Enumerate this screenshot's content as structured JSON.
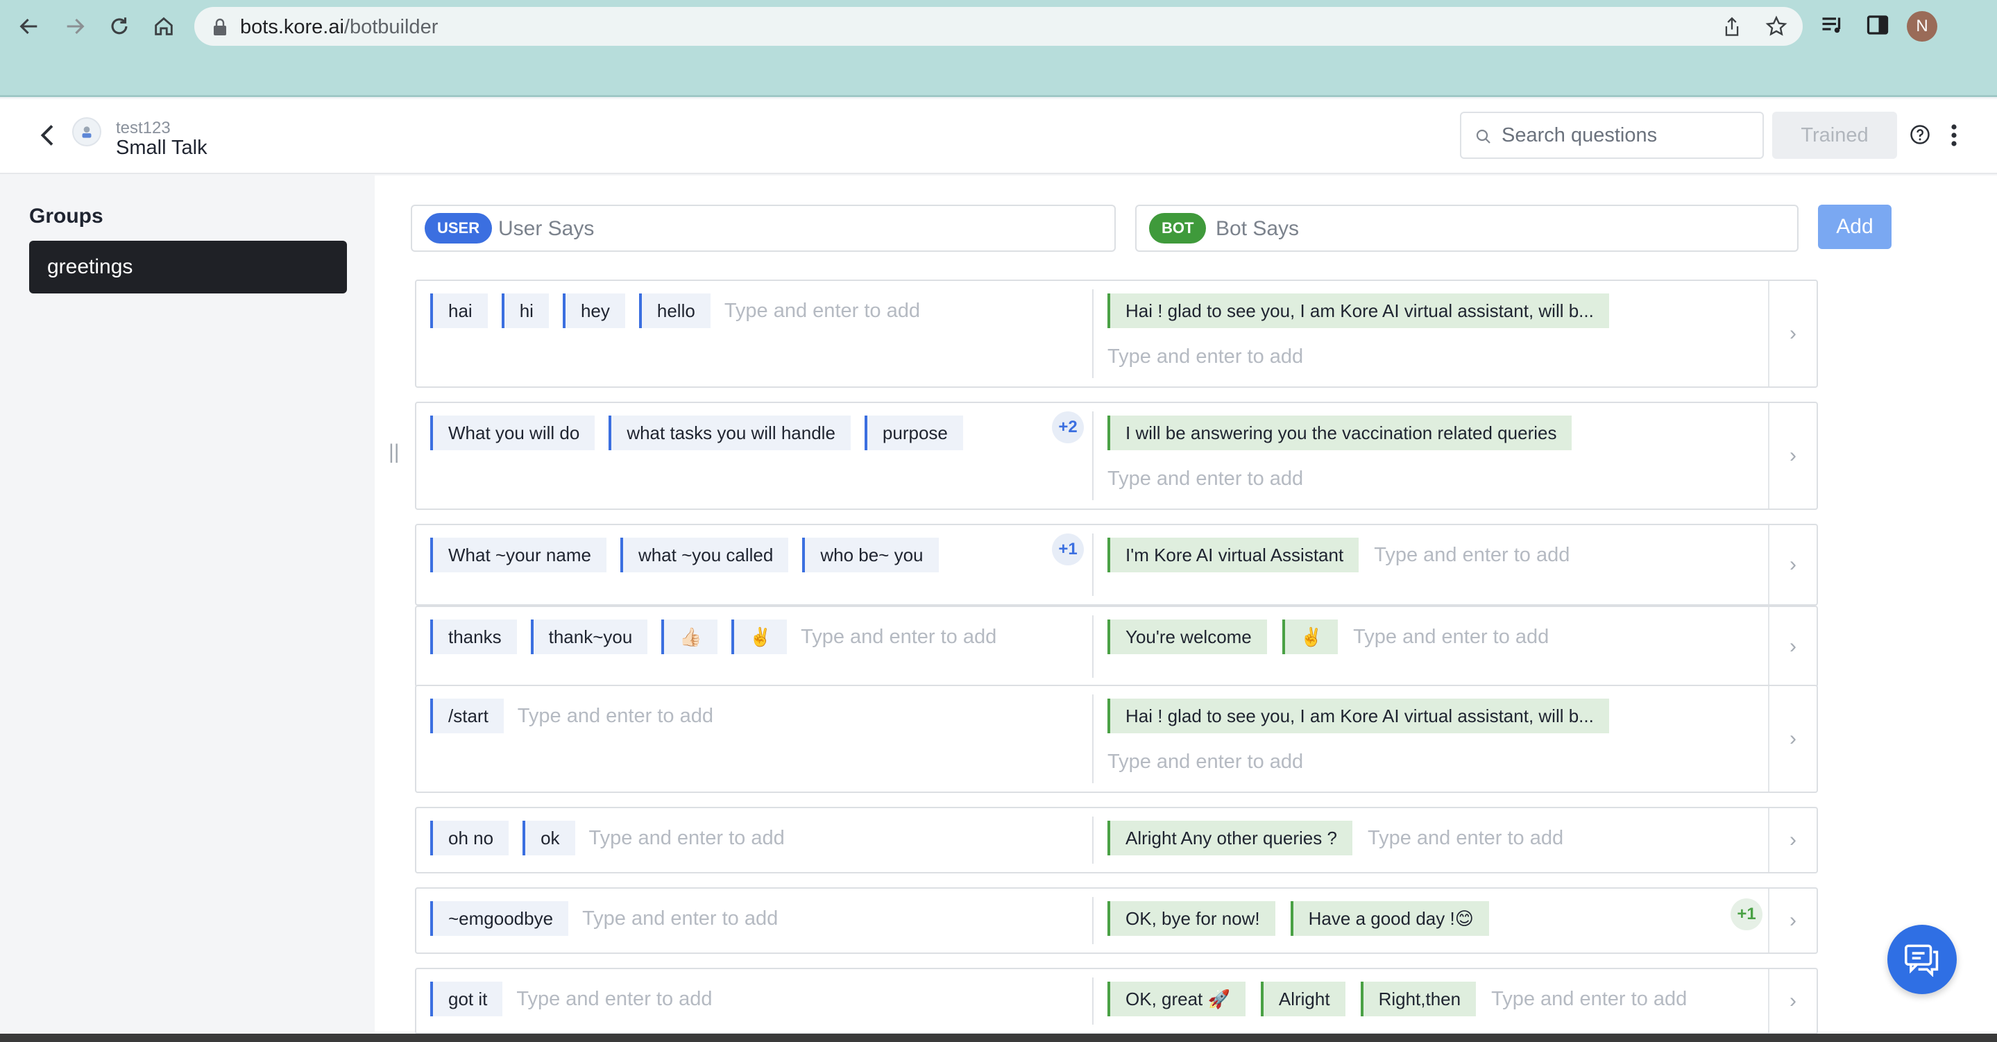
{
  "browser": {
    "url_host": "bots.kore.ai",
    "url_path": "/botbuilder",
    "avatar_letter": "N"
  },
  "header": {
    "bot_name": "test123",
    "page_title": "Small Talk",
    "search_placeholder": "Search questions",
    "trained_label": "Trained"
  },
  "sidebar": {
    "heading": "Groups",
    "groups": [
      "greetings"
    ]
  },
  "composer": {
    "user_tag": "USER",
    "user_placeholder": "User Says",
    "bot_tag": "BOT",
    "bot_placeholder": "Bot Says",
    "add_label": "Add"
  },
  "type_placeholder": "Type and enter to add",
  "rows": [
    {
      "user": [
        "hai",
        "hi",
        "hey",
        "hello"
      ],
      "user_more": "",
      "bot": [
        "Hai ! glad to see you, I am Kore AI virtual assistant, will b..."
      ],
      "bot_more": ""
    },
    {
      "user": [
        "What you will do",
        "what tasks you will handle",
        "purpose"
      ],
      "user_more": "+2",
      "bot": [
        "I will be answering you the vaccination related queries"
      ],
      "bot_more": ""
    },
    {
      "user": [
        "What ~your name",
        "what ~you called",
        "who be~ you"
      ],
      "user_more": "+1",
      "bot": [
        "I'm Kore AI virtual Assistant"
      ],
      "bot_more": ""
    },
    {
      "user": [
        "thanks",
        "thank~you",
        "👍🏻",
        "✌️"
      ],
      "user_more": "",
      "bot": [
        "You're welcome",
        "✌️"
      ],
      "bot_more": ""
    },
    {
      "user": [
        "/start"
      ],
      "user_more": "",
      "bot": [
        "Hai ! glad to see you, I am Kore AI virtual assistant, will b..."
      ],
      "bot_more": ""
    },
    {
      "user": [
        "oh no",
        "ok"
      ],
      "user_more": "",
      "bot": [
        "Alright Any other queries ?"
      ],
      "bot_more": ""
    },
    {
      "user": [
        "~emgoodbye"
      ],
      "user_more": "",
      "bot": [
        "OK, bye for now!",
        "Have a good day !😊"
      ],
      "bot_more": "+1"
    },
    {
      "user": [
        "got it"
      ],
      "user_more": "",
      "bot": [
        "OK, great 🚀",
        "Alright",
        "Right,then"
      ],
      "bot_more": ""
    }
  ],
  "colors": {
    "user_accent": "#3b6fe0",
    "bot_accent": "#4aa145",
    "chrome_bg": "#b7dddb"
  },
  "icons": [
    "back-arrow-icon",
    "forward-arrow-icon",
    "reload-icon",
    "home-icon",
    "lock-icon",
    "share-icon",
    "star-icon",
    "playlist-icon",
    "sidepanel-icon",
    "search-icon",
    "help-icon",
    "kebab-menu-icon",
    "drag-handle-icon",
    "chevron-right-icon",
    "chat-icon"
  ]
}
